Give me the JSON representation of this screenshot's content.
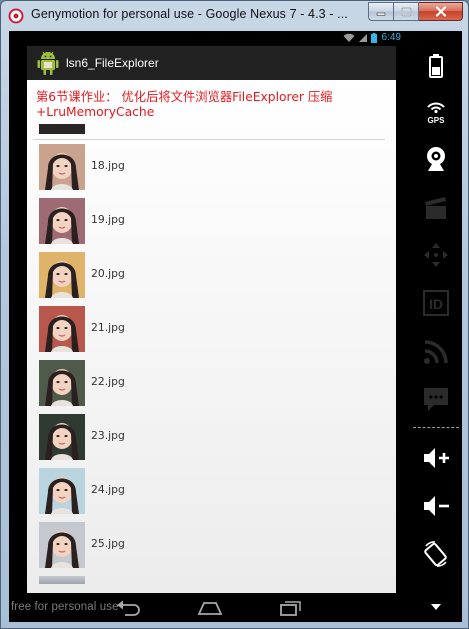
{
  "window": {
    "title": "Genymotion for personal use - Google Nexus 7 - 4.3 - ...",
    "buttons": {
      "minimize": "minimize-button",
      "maximize": "maximize-button",
      "close": "close-button"
    }
  },
  "statusbar": {
    "time": "6:49"
  },
  "app": {
    "title": "lsn6_FileExplorer",
    "homework_text": "第6节课作业： 优化后将文件浏览器FileExplorer 压缩+LruMemoryCache"
  },
  "files": [
    {
      "name": "18.jpg",
      "tone": "#c9a38e"
    },
    {
      "name": "19.jpg",
      "tone": "#9e6b74"
    },
    {
      "name": "20.jpg",
      "tone": "#e0b36b"
    },
    {
      "name": "21.jpg",
      "tone": "#b8584d"
    },
    {
      "name": "22.jpg",
      "tone": "#4f5a4a"
    },
    {
      "name": "23.jpg",
      "tone": "#2f3a33"
    },
    {
      "name": "24.jpg",
      "tone": "#b9d3df"
    },
    {
      "name": "25.jpg",
      "tone": "#c5c8ce"
    }
  ],
  "navbar": {
    "watermark": "free for personal use"
  },
  "sidebar_icons": [
    "battery-icon",
    "gps-icon",
    "webcam-icon",
    "clapperboard-icon",
    "dpad-icon",
    "id-icon",
    "rss-icon",
    "message-icon",
    "volume-up-icon",
    "volume-down-icon",
    "rotate-icon",
    "more-icon"
  ],
  "colors": {
    "accent_status": "#33b5e5",
    "homework_text": "#e8191d",
    "actionbar": "#222222"
  }
}
